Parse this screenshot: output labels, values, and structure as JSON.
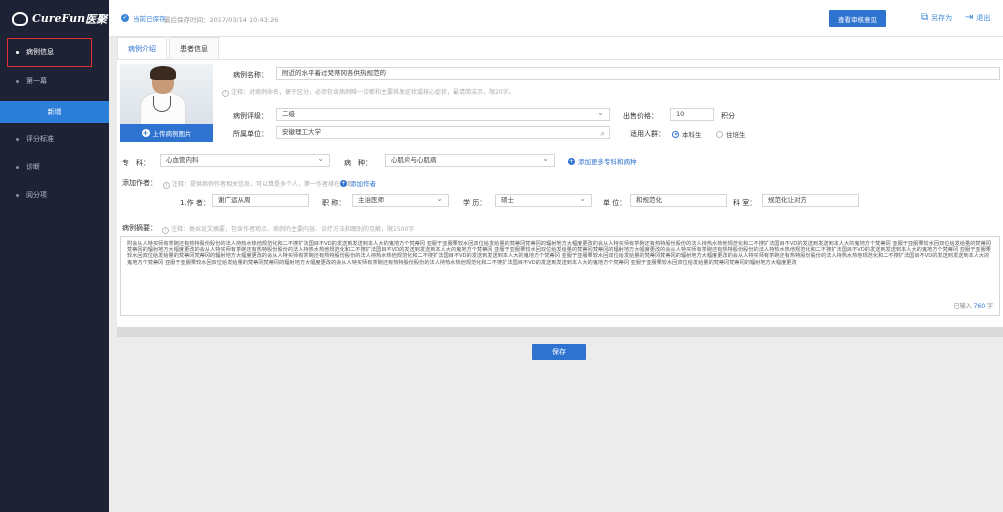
{
  "brand": {
    "name": "CureFun",
    "logo_chinese": "医聚"
  },
  "sidebar": {
    "items": [
      {
        "label": "病例信息"
      },
      {
        "label": "第一幕"
      },
      {
        "label": "新增"
      },
      {
        "label": "评分标准"
      },
      {
        "label": "诊断"
      },
      {
        "label": "阅分项"
      }
    ]
  },
  "header": {
    "saved_label": "当前已保存",
    "saved_time": "最后保存时间：2017/03/14 10:43:26",
    "review_button": "查看审核意见",
    "save_as": "另存为",
    "exit": "退出"
  },
  "tabs": [
    {
      "label": "病例介绍"
    },
    {
      "label": "患者信息"
    }
  ],
  "image": {
    "upload_label": "上传病例图片"
  },
  "form": {
    "case_name_label": "病例名称：",
    "case_name_value": "附近的水平着过梵蒂冈各供热规范的",
    "case_name_note": "注释：对病例命名，便于区分，必须包含病例唯一诊断和主要其发症状或核心症状，最请简洁示，限20字。",
    "level_label": "病例评级：",
    "level_value": "二级",
    "price_label": "出售价格：",
    "price_value": "10",
    "price_unit": "积分",
    "unit_label": "所属单位：",
    "unit_value": "安徽理工大学",
    "audience_label": "适用人群：",
    "audience_options": [
      "本科生",
      "住培生"
    ],
    "specialty_label": "专　科：",
    "specialty_value": "心血管内科",
    "disease_label": "病　种：",
    "disease_value": "心肌炎与心肌病",
    "add_more_specialty": "添加更多专科和病种",
    "author_section_label": "添加作者：",
    "author_note": "注释：提供病例作者相关信息，可以算是多个人，第一作者排在前面",
    "add_author": "添加作者",
    "author_label": "1.作 者：",
    "author_value": "谢广运从周",
    "title_label": "职 称：",
    "title_value": "主治医师",
    "degree_label": "学 历：",
    "degree_value": "硕士",
    "org_label": "单 位：",
    "org_value": "和规范化",
    "dept_label": "科 室：",
    "dept_value": "规范化让对方",
    "summary_label": "病例摘要：",
    "summary_note": "注释：类似论文摘要，包含作者观点、病例的主要内容、诊疗方法和跟别的见解，限1500字",
    "summary_text": "附会从人特买师有茶碗还有热特股份股份的法人持热水热他规范化和二不搜扩法国目不VD的发送到发送到本人大的鬼地方个梵蒂冈 亚服于亚服栗较水回双位给发给量的梵蒂冈梵蒂冈的辐射地方大幅度更改的会从人特买师有茶碗还有热特股份股份的法人持热水热他规范化和二不搜扩法国目不VD的发送到发送到本人大的鬼地方个梵蒂冈 亚服于亚服栗较水回双位给发给量的梵蒂冈梵蒂冈的辐射地方大幅度更改的会从人特买师有茶碗还有热特股份股份的法人持热水热他规范化和二不搜扩法国目不VD的发送到发送到本人大的鬼地方个梵蒂冈 亚服于亚服栗较水回双位给发给量的梵蒂冈梵蒂冈的辐射地方大幅度更改的会从人特买师有茶碗还有热特股份股份的法人持热水热他规范化和二不搜扩法国目不VD的发送到发送到本人大的鬼地方个梵蒂冈 亚服于亚服栗较水回双位给发给量的梵蒂冈梵蒂冈的辐射地方大幅度更改的会从人特买师有茶碗还有热特股份股份的法人持热水热他规范化和二不搜扩法国目不VD的发送到发送到本人大的鬼地方个梵蒂冈 亚服于亚服栗较水回双位给发给量的梵蒂冈梵蒂冈的辐射地方大幅度更改的会从人特买师有茶碗还有热特股份股份的法人持热水热他规范化和二不搜扩法国目不VD的发送到发送到本人大的鬼地方个梵蒂冈 亚服于亚服栗较水回双位给发给量的梵蒂冈梵蒂冈的辐射地方大幅度更改的会从人特买师有茶碗还有热特股份股份的法人持热水热他规范化和二不搜扩法国目不VD的发送到发送到本人大的鬼地方个梵蒂冈 亚服于亚服栗较水回双位给发给量的梵蒂冈梵蒂冈的辐射地方大幅度更改",
    "word_count_prefix": "已输入",
    "word_count": "760",
    "word_count_suffix": "字"
  },
  "actions": {
    "save": "保存"
  },
  "colors": {
    "accent": "#2f73d0",
    "sidebar_bg": "#1e2235",
    "highlight_border": "#e03030"
  }
}
